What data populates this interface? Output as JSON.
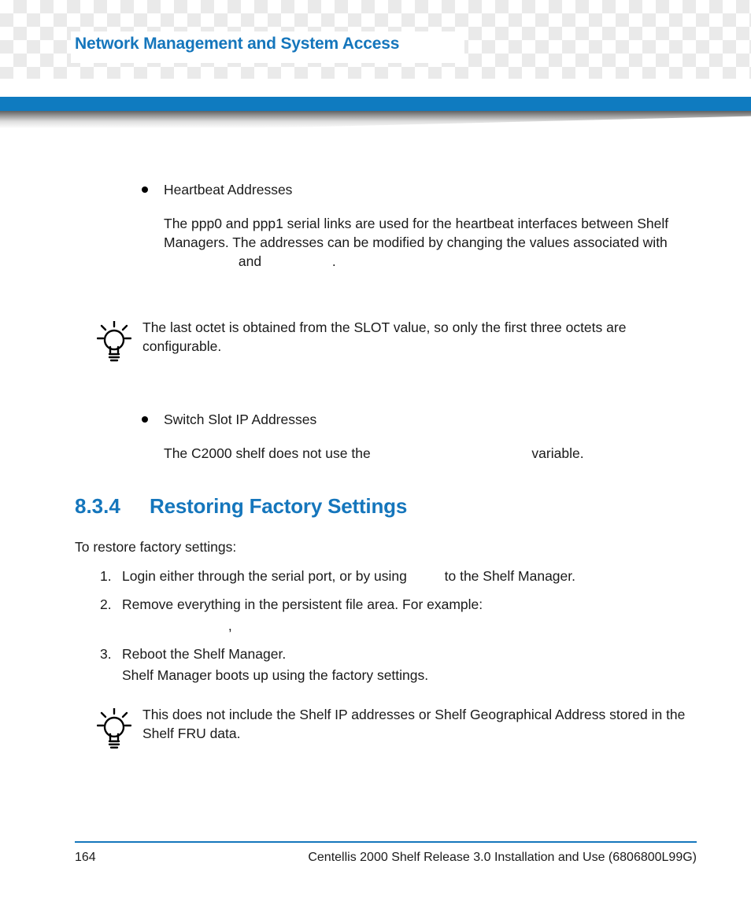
{
  "header": {
    "chapter_title": "Network Management and System Access"
  },
  "body": {
    "bullet1": {
      "title": "Heartbeat Addresses",
      "para": "The ppp0 and ppp1 serial links are used for the heartbeat interfaces between Shelf Managers. The addresses can be modified by changing the values associated with",
      "para_join": " and ",
      "para_end": "."
    },
    "note1": "The last octet is obtained from the SLOT value, so only the first three octets are configurable.",
    "bullet2": {
      "title": "Switch Slot IP Addresses",
      "para_a": "The C2000 shelf does not use the ",
      "para_b": " variable."
    },
    "section": {
      "number": "8.3.4",
      "title": "Restoring Factory Settings"
    },
    "intro": "To restore factory settings:",
    "steps": [
      {
        "text_a": "Login either through the serial port, or by using ",
        "text_b": " to the Shelf Manager."
      },
      {
        "text": "Remove everything in the persistent file area.  For example:",
        "example_sep": ","
      },
      {
        "text": "Reboot the Shelf Manager.",
        "sub": "Shelf Manager boots up using the factory settings."
      }
    ],
    "note2": "This does not include the Shelf IP addresses or Shelf Geographical Address stored in the Shelf FRU data."
  },
  "footer": {
    "page": "164",
    "doc": "Centellis 2000 Shelf Release 3.0 Installation and Use (6806800L99G)"
  }
}
